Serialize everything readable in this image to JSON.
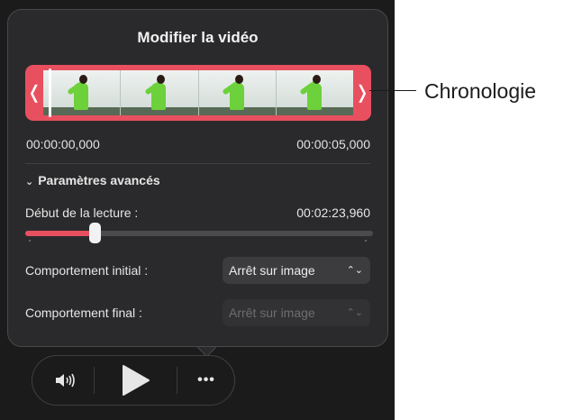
{
  "popover": {
    "title": "Modifier la vidéo",
    "timeline": {
      "left_handle": "❬",
      "right_handle": "❭",
      "start_time": "00:00:00,000",
      "end_time": "00:00:05,000"
    },
    "advanced": {
      "chevron": "⌄",
      "label": "Paramètres avancés"
    },
    "playback_start": {
      "label": "Début de la lecture :",
      "value": "00:02:23,960",
      "slider_fraction": 0.2
    },
    "initial_behavior": {
      "label": "Comportement initial :",
      "value": "Arrêt sur image"
    },
    "final_behavior": {
      "label": "Comportement final :",
      "value": "Arrêt sur image"
    },
    "updown_glyph": "⌃⌄"
  },
  "controls": {
    "volume_icon": "speaker-wave-icon",
    "play_icon": "play-icon",
    "more_label": "•••"
  },
  "callout": {
    "label": "Chronologie"
  },
  "colors": {
    "accent": "#e8505f",
    "panel": "#2a2a2c",
    "background": "#1b1b1c"
  }
}
